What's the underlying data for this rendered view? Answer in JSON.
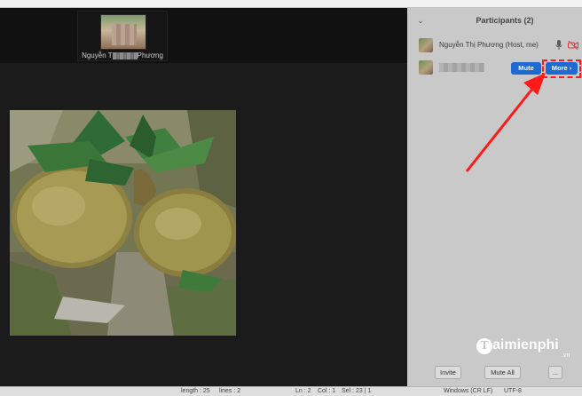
{
  "thumbnail": {
    "name_prefix": "Nguyễn T",
    "name_suffix": "Phương"
  },
  "participants_panel": {
    "title": "Participants (2)",
    "participants": [
      {
        "name": "Nguyễn Thị Phương (Host, me)",
        "mic": "mic-icon",
        "video": "video-off-icon"
      },
      {
        "name": "",
        "mute_label": "Mute",
        "more_label": "More",
        "more_chevron": "›"
      }
    ],
    "footer": {
      "invite_label": "Invite",
      "mute_all_label": "Mute All",
      "more_dots_label": "..."
    }
  },
  "annotation": {
    "highlight_color": "#ff1a1a"
  },
  "watermark": {
    "brand": "aimienphi",
    "initial": "T",
    "tld": ".vn"
  },
  "statusbar": {
    "length": "length : 25",
    "lines": "lines : 2",
    "ln": "Ln : 2",
    "col": "Col : 1",
    "sel": "Sel : 23 | 1",
    "eol": "Windows (CR LF)",
    "encoding": "UTF-8"
  },
  "colors": {
    "accent": "#1e6ad1",
    "panel_bg": "#c9c9c9",
    "video_bg": "#1b1b1b"
  }
}
